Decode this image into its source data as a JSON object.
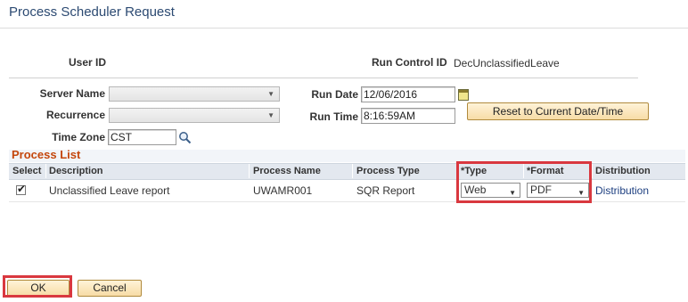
{
  "page": {
    "title": "Process Scheduler Request"
  },
  "header": {
    "user_id_label": "User ID",
    "run_control_label": "Run Control ID",
    "run_control_value": "DecUnclassifiedLeave"
  },
  "form": {
    "server_name_label": "Server Name",
    "server_name_value": "",
    "recurrence_label": "Recurrence",
    "recurrence_value": "",
    "time_zone_label": "Time Zone",
    "time_zone_value": "CST",
    "run_date_label": "Run Date",
    "run_date_value": "12/06/2016",
    "run_time_label": "Run Time",
    "run_time_value": "8:16:59AM",
    "reset_button": "Reset to Current Date/Time"
  },
  "process_list": {
    "title": "Process List",
    "columns": [
      "Select",
      "Description",
      "Process Name",
      "Process Type",
      "*Type",
      "*Format",
      "Distribution"
    ],
    "rows": [
      {
        "selected": true,
        "description": "Unclassified Leave report",
        "process_name": "UWAMR001",
        "process_type": "SQR Report",
        "type": "Web",
        "format": "PDF",
        "distribution": "Distribution"
      }
    ]
  },
  "actions": {
    "ok": "OK",
    "cancel": "Cancel"
  },
  "icons": {
    "lookup": "magnifier-icon",
    "calendar": "calendar-icon",
    "dropdown": "chevron-down-icon"
  },
  "colors": {
    "title": "#2c4a72",
    "section_title": "#c4470c",
    "highlight": "#d9383f",
    "link": "#1d3f80"
  }
}
